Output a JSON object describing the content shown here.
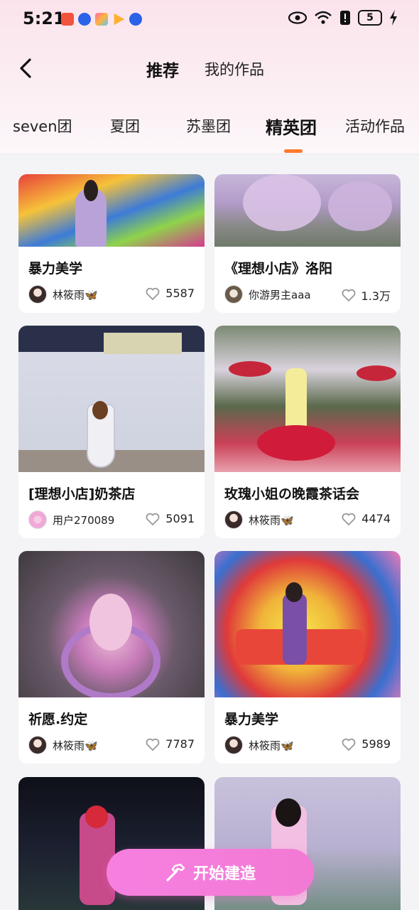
{
  "status_bar": {
    "time": "5:21",
    "battery": "5"
  },
  "header": {
    "active_tab": "推荐",
    "tab2": "我的作品"
  },
  "categories": [
    "seven团",
    "夏团",
    "苏墨团",
    "精英团",
    "活动作品"
  ],
  "active_category": "精英团",
  "cards": [
    {
      "title": "暴力美学",
      "author": "林筱雨🦋",
      "likes": "5587"
    },
    {
      "title": "《理想小店》洛阳",
      "author": "你游男主aaa",
      "likes": "1.3万"
    },
    {
      "title": "[理想小店]奶茶店",
      "author": "用户270089",
      "likes": "5091"
    },
    {
      "title": "玫瑰小姐の晚霞茶话会",
      "author": "林筱雨🦋",
      "likes": "4474"
    },
    {
      "title": "祈愿.约定",
      "author": "林筱雨🦋",
      "likes": "7787"
    },
    {
      "title": "暴力美学",
      "author": "林筱雨🦋",
      "likes": "5989"
    }
  ],
  "build_button": "开始建造",
  "colors": {
    "accent": "#ff7a2e",
    "button": "#f57bd8"
  }
}
